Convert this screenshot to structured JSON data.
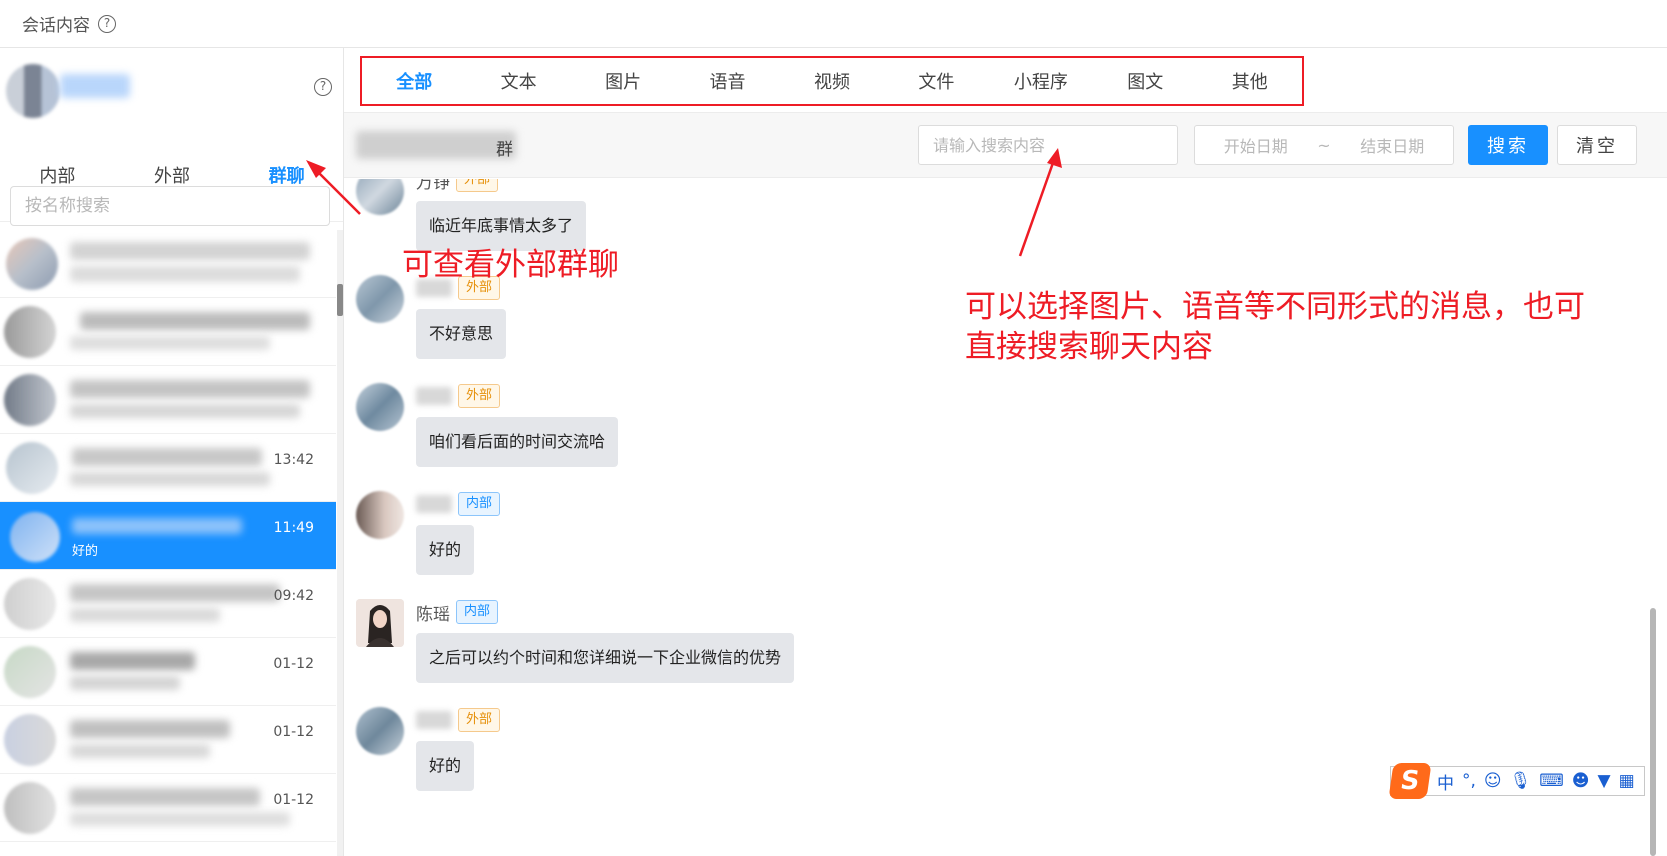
{
  "header": {
    "title": "会话内容",
    "help_icon": "?"
  },
  "sidebar": {
    "help_icon": "?",
    "tabs": [
      "内部",
      "外部",
      "群聊"
    ],
    "active_tab": "群聊",
    "search_placeholder": "按名称搜索",
    "conversations": [
      {
        "time": "",
        "preview": ""
      },
      {
        "time": "",
        "preview": ""
      },
      {
        "time": "",
        "preview": ""
      },
      {
        "time": "13:42",
        "preview": ""
      },
      {
        "time": "11:49",
        "preview": "好的"
      },
      {
        "time": "09:42",
        "preview": ""
      },
      {
        "time": "01-12",
        "preview": ""
      },
      {
        "time": "01-12",
        "preview": ""
      },
      {
        "time": "01-12",
        "preview": ""
      }
    ]
  },
  "main": {
    "type_tabs": [
      "全部",
      "文本",
      "图片",
      "语音",
      "视频",
      "文件",
      "小程序",
      "图文",
      "其他"
    ],
    "active_type": "全部",
    "group_suffix": "群",
    "search_placeholder": "请输入搜索内容",
    "start_date_placeholder": "开始日期",
    "date_separator": "~",
    "end_date_placeholder": "结束日期",
    "search_button": "搜索",
    "clear_button": "清空",
    "messages": [
      {
        "sender": "万铮",
        "tag": "外部",
        "text": "临近年底事情太多了"
      },
      {
        "sender": "",
        "tag": "外部",
        "text": "不好意思"
      },
      {
        "sender": "",
        "tag": "外部",
        "text": "咱们看后面的时间交流哈"
      },
      {
        "sender": "",
        "tag": "内部",
        "text": "好的"
      },
      {
        "sender": "陈瑶",
        "tag": "内部",
        "text": "之后可以约个时间和您详细说一下企业微信的优势"
      },
      {
        "sender": "",
        "tag": "外部",
        "text": "好的"
      }
    ]
  },
  "annotations": {
    "group_chat_note": "可查看外部群聊",
    "filter_note_line1": "可以选择图片、语音等不同形式的消息，也可",
    "filter_note_line2": "直接搜索聊天内容",
    "color": "#ee1c25"
  },
  "ime_toolbar": {
    "logo": "S",
    "mode": "中",
    "punct": "°,"
  },
  "colors": {
    "accent": "#1890ff",
    "annotation": "#ee1c25",
    "external_tag": "#e6900a",
    "internal_tag": "#1890ff"
  }
}
